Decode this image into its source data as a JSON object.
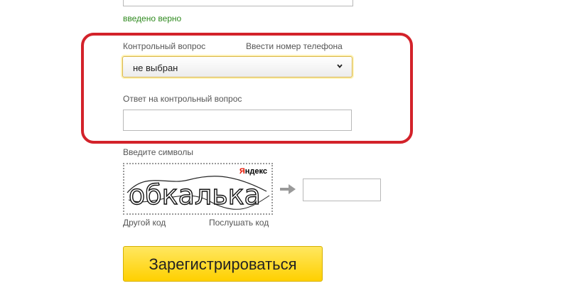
{
  "previous_field": {
    "status": "введено верно",
    "status_color": "#2f8a1f"
  },
  "highlight_color": "#d3222a",
  "security_question": {
    "label": "Контрольный вопрос",
    "phone_link": "Ввести номер телефона",
    "selected": "не выбран",
    "answer_label": "Ответ на контрольный вопрос",
    "answer_value": ""
  },
  "captcha": {
    "label": "Введите символы",
    "image_text": "обкалька",
    "brand_first": "Я",
    "brand_rest": "ндекс",
    "input_value": "",
    "other_code": "Другой код",
    "listen_code": "Послушать код"
  },
  "submit": {
    "label": "Зарегистрироваться",
    "color": "#ffd000"
  }
}
